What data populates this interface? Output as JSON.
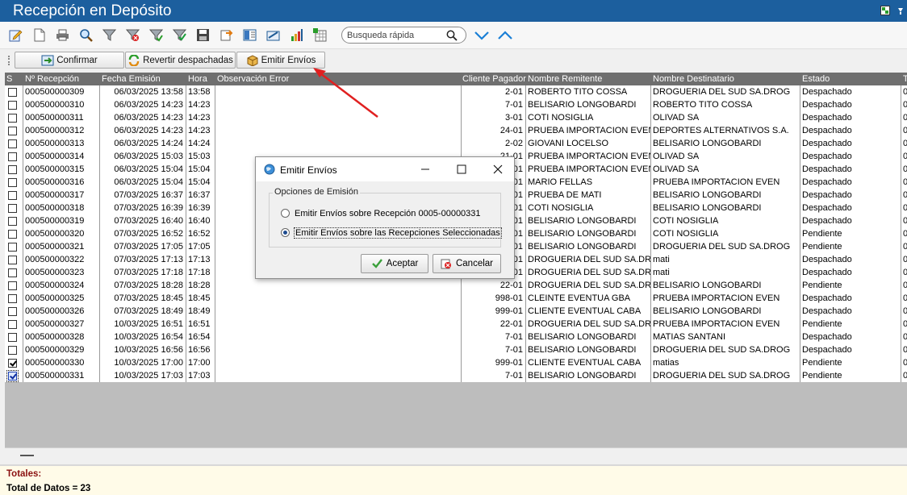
{
  "window": {
    "title": "Recepción en Depósito"
  },
  "search": {
    "placeholder": "Busqueda rápida"
  },
  "actions": {
    "confirm": "Confirmar",
    "revert": "Revertir despachadas",
    "emit": "Emitir Envíos"
  },
  "grid": {
    "headers": [
      "S",
      "Nº Recepción",
      "Fecha Emisión",
      "Hora",
      "Observación Error",
      "Cliente Pagador",
      "Nombre Remitente",
      "Nombre Destinatario",
      "Estado",
      "T"
    ],
    "rows": [
      {
        "checked": false,
        "nro": "000500000309",
        "fecha": "06/03/2025 13:58",
        "hora": "13:58",
        "obs": "",
        "cliente": "2-01",
        "remitente": "ROBERTO TITO COSSA",
        "destinatario": "DROGUERIA DEL SUD SA.DROG",
        "estado": "Despachado",
        "t": "0"
      },
      {
        "checked": false,
        "nro": "000500000310",
        "fecha": "06/03/2025 14:23",
        "hora": "14:23",
        "obs": "",
        "cliente": "7-01",
        "remitente": "BELISARIO LONGOBARDI",
        "destinatario": "ROBERTO TITO COSSA",
        "estado": "Despachado",
        "t": "0"
      },
      {
        "checked": false,
        "nro": "000500000311",
        "fecha": "06/03/2025 14:23",
        "hora": "14:23",
        "obs": "",
        "cliente": "3-01",
        "remitente": "COTI NOSIGLIA",
        "destinatario": "OLIVAD SA",
        "estado": "Despachado",
        "t": "0"
      },
      {
        "checked": false,
        "nro": "000500000312",
        "fecha": "06/03/2025 14:23",
        "hora": "14:23",
        "obs": "",
        "cliente": "24-01",
        "remitente": "PRUEBA IMPORTACION EVEN",
        "destinatario": "DEPORTES ALTERNATIVOS S.A.",
        "estado": "Despachado",
        "t": "0"
      },
      {
        "checked": false,
        "nro": "000500000313",
        "fecha": "06/03/2025 14:24",
        "hora": "14:24",
        "obs": "",
        "cliente": "2-02",
        "remitente": "GIOVANI LOCELSO",
        "destinatario": "BELISARIO LONGOBARDI",
        "estado": "Despachado",
        "t": "0"
      },
      {
        "checked": false,
        "nro": "000500000314",
        "fecha": "06/03/2025 15:03",
        "hora": "15:03",
        "obs": "",
        "cliente": "21-01",
        "remitente": "PRUEBA IMPORTACION EVEN",
        "destinatario": "OLIVAD SA",
        "estado": "Despachado",
        "t": "0"
      },
      {
        "checked": false,
        "nro": "000500000315",
        "fecha": "06/03/2025 15:04",
        "hora": "15:04",
        "obs": "",
        "cliente": "21-01",
        "remitente": "PRUEBA IMPORTACION EVEN",
        "destinatario": "OLIVAD SA",
        "estado": "Despachado",
        "t": "0"
      },
      {
        "checked": false,
        "nro": "000500000316",
        "fecha": "06/03/2025 15:04",
        "hora": "15:04",
        "obs": "",
        "cliente": "10-01",
        "remitente": "MARIO FELLAS",
        "destinatario": "PRUEBA IMPORTACION EVEN",
        "estado": "Despachado",
        "t": "0"
      },
      {
        "checked": false,
        "nro": "000500000317",
        "fecha": "07/03/2025 16:37",
        "hora": "16:37",
        "obs": "",
        "cliente": "22-01",
        "remitente": "PRUEBA DE MATI",
        "destinatario": "BELISARIO LONGOBARDI",
        "estado": "Despachado",
        "t": "0"
      },
      {
        "checked": false,
        "nro": "000500000318",
        "fecha": "07/03/2025 16:39",
        "hora": "16:39",
        "obs": "",
        "cliente": "3-01",
        "remitente": "COTI NOSIGLIA",
        "destinatario": "BELISARIO LONGOBARDI",
        "estado": "Despachado",
        "t": "0"
      },
      {
        "checked": false,
        "nro": "000500000319",
        "fecha": "07/03/2025 16:40",
        "hora": "16:40",
        "obs": "",
        "cliente": "7-01",
        "remitente": "BELISARIO LONGOBARDI",
        "destinatario": "COTI NOSIGLIA",
        "estado": "Despachado",
        "t": "0"
      },
      {
        "checked": false,
        "nro": "000500000320",
        "fecha": "07/03/2025 16:52",
        "hora": "16:52",
        "obs": "",
        "cliente": "7-01",
        "remitente": "BELISARIO LONGOBARDI",
        "destinatario": "COTI NOSIGLIA",
        "estado": "Pendiente",
        "t": "0"
      },
      {
        "checked": false,
        "nro": "000500000321",
        "fecha": "07/03/2025 17:05",
        "hora": "17:05",
        "obs": "",
        "cliente": "7-01",
        "remitente": "BELISARIO LONGOBARDI",
        "destinatario": "DROGUERIA DEL SUD SA.DROG",
        "estado": "Pendiente",
        "t": "0"
      },
      {
        "checked": false,
        "nro": "000500000322",
        "fecha": "07/03/2025 17:13",
        "hora": "17:13",
        "obs": "",
        "cliente": "22-01",
        "remitente": "DROGUERIA DEL SUD SA.DROG",
        "destinatario": "mati",
        "estado": "Despachado",
        "t": "0"
      },
      {
        "checked": false,
        "nro": "000500000323",
        "fecha": "07/03/2025 17:18",
        "hora": "17:18",
        "obs": "",
        "cliente": "22-01",
        "remitente": "DROGUERIA DEL SUD SA.DROG",
        "destinatario": "mati",
        "estado": "Despachado",
        "t": "0"
      },
      {
        "checked": false,
        "nro": "000500000324",
        "fecha": "07/03/2025 18:28",
        "hora": "18:28",
        "obs": "",
        "cliente": "22-01",
        "remitente": "DROGUERIA DEL SUD SA.DROG",
        "destinatario": "BELISARIO LONGOBARDI",
        "estado": "Pendiente",
        "t": "0"
      },
      {
        "checked": false,
        "nro": "000500000325",
        "fecha": "07/03/2025 18:45",
        "hora": "18:45",
        "obs": "",
        "cliente": "998-01",
        "remitente": "CLEINTE EVENTUA GBA",
        "destinatario": "PRUEBA IMPORTACION EVEN",
        "estado": "Despachado",
        "t": "0"
      },
      {
        "checked": false,
        "nro": "000500000326",
        "fecha": "07/03/2025 18:49",
        "hora": "18:49",
        "obs": "",
        "cliente": "999-01",
        "remitente": "CLIENTE EVENTUAL CABA",
        "destinatario": "BELISARIO LONGOBARDI",
        "estado": "Despachado",
        "t": "0"
      },
      {
        "checked": false,
        "nro": "000500000327",
        "fecha": "10/03/2025 16:51",
        "hora": "16:51",
        "obs": "",
        "cliente": "22-01",
        "remitente": "DROGUERIA DEL SUD SA.DROG",
        "destinatario": "PRUEBA IMPORTACION EVEN",
        "estado": "Pendiente",
        "t": "0"
      },
      {
        "checked": false,
        "nro": "000500000328",
        "fecha": "10/03/2025 16:54",
        "hora": "16:54",
        "obs": "",
        "cliente": "7-01",
        "remitente": "BELISARIO LONGOBARDI",
        "destinatario": "MATIAS SANTANI",
        "estado": "Despachado",
        "t": "0"
      },
      {
        "checked": false,
        "nro": "000500000329",
        "fecha": "10/03/2025 16:56",
        "hora": "16:56",
        "obs": "",
        "cliente": "7-01",
        "remitente": "BELISARIO LONGOBARDI",
        "destinatario": "DROGUERIA DEL SUD SA.DROG",
        "estado": "Despachado",
        "t": "0"
      },
      {
        "checked": true,
        "nro": "000500000330",
        "fecha": "10/03/2025 17:00",
        "hora": "17:00",
        "obs": "",
        "cliente": "999-01",
        "remitente": "CLIENTE EVENTUAL CABA",
        "destinatario": "matias",
        "estado": "Pendiente",
        "t": "0"
      },
      {
        "checked": true,
        "focus": true,
        "nro": "000500000331",
        "fecha": "10/03/2025 17:03",
        "hora": "17:03",
        "obs": "",
        "cliente": "7-01",
        "remitente": "BELISARIO LONGOBARDI",
        "destinatario": "DROGUERIA DEL SUD SA.DROG",
        "estado": "Pendiente",
        "t": "0"
      }
    ]
  },
  "totals": {
    "label": "Totales:",
    "count_text": "Total de Datos = 23"
  },
  "dialog": {
    "title": "Emitir Envíos",
    "group_label": "Opciones de Emisión",
    "option1": "Emitir Envíos sobre Recepción 0005-00000331",
    "option2": "Emitir Envíos sobre las Recepciones Seleccionadas",
    "selected_option": 2,
    "ok": "Aceptar",
    "cancel": "Cancelar"
  },
  "colors": {
    "titlebar": "#1c5f9e",
    "header": "#6f6f6f",
    "annotation_arrow": "#e02020",
    "chevrons": "#1a7fd6"
  }
}
